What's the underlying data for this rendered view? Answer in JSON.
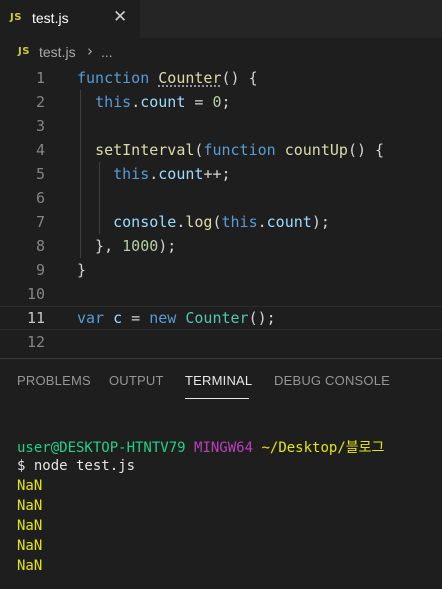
{
  "tab": {
    "badge": "JS",
    "filename": "test.js",
    "close_glyph": "✕"
  },
  "breadcrumb": {
    "badge": "JS",
    "file": "test.js",
    "separator": "›",
    "more": "..."
  },
  "editor": {
    "line_numbers": [
      "1",
      "2",
      "3",
      "4",
      "5",
      "6",
      "7",
      "8",
      "9",
      "10",
      "11",
      "12"
    ],
    "current_line": 11
  },
  "panel": {
    "tabs": [
      "PROBLEMS",
      "OUTPUT",
      "TERMINAL",
      "DEBUG CONSOLE"
    ],
    "active_tab": "TERMINAL"
  },
  "terminal": {
    "prompt_user": "user@DESKTOP-HTNTV79",
    "prompt_shell": "MINGW64",
    "prompt_path": "~/Desktop/블로그",
    "command": "$ node test.js",
    "output": [
      "NaN",
      "NaN",
      "NaN",
      "NaN",
      "NaN"
    ]
  },
  "colors": {
    "keyword": "#569cd6",
    "function": "#dcdcaa",
    "type": "#4ec9b0",
    "variable": "#9cdcfe",
    "number": "#b5cea8",
    "terminal_green": "#23d18b",
    "terminal_purple": "#bc3fbc",
    "terminal_yellow": "#e5e510"
  },
  "icons": {
    "tab": "js-file-icon",
    "close": "close-icon",
    "breadcrumb": "js-file-icon"
  }
}
